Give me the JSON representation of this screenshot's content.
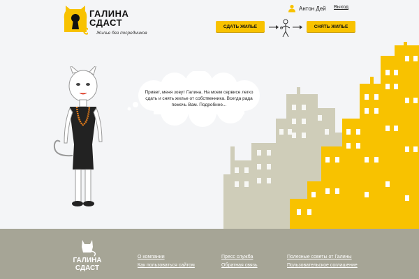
{
  "header": {
    "logo_title_line1": "ГАЛИНА",
    "logo_title_line2": "СДАСТ",
    "logo_tagline": "Жилье без посредников",
    "user_name": "Антон Дей",
    "exit_link": "Выход",
    "btn_rent_out": "СДАТЬ ЖИЛЬЕ",
    "btn_rent": "СНЯТЬ ЖИЛЬЕ",
    "accent_color": "#f8c200"
  },
  "hero": {
    "greeting": "Привет, меня зовут Галина. На моем сервисе легко сдать и снять жилье от собственника. Всегда рада помочь Вам. Подробнее..."
  },
  "footer": {
    "logo_line1": "ГАЛИНА",
    "logo_line2": "СДАСТ",
    "links": [
      "О компании",
      "Как пользоваться сайтом",
      "Пресс служба",
      "Обратная связь",
      "Полезные советы от Галины",
      "Пользовательское соглашение"
    ]
  }
}
